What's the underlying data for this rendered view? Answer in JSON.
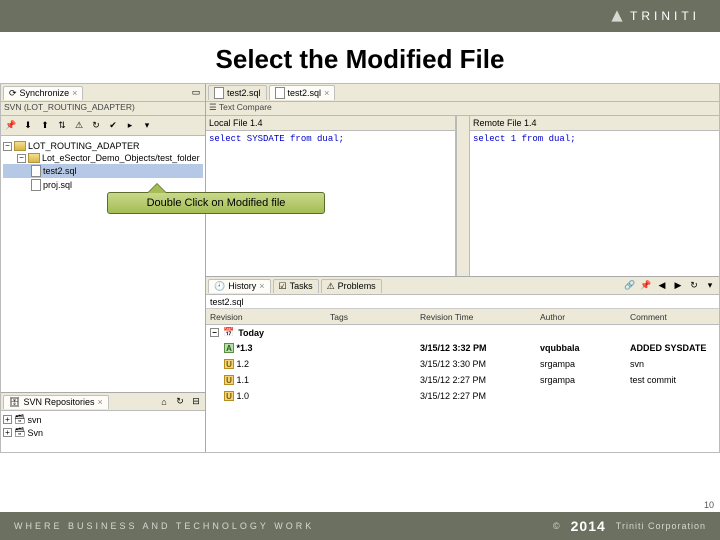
{
  "brand": {
    "name": "TRINITI",
    "tagline": "WHERE BUSINESS AND TECHNOLOGY WORK",
    "year": "2014",
    "corp": "Triniti Corporation"
  },
  "slide": {
    "title": "Select the Modified File",
    "page": "10"
  },
  "callout": {
    "text": "Double Click on  Modified file"
  },
  "sync": {
    "tab": "Synchronize",
    "desc": "SVN (LOT_ROUTING_ADAPTER)",
    "root": "LOT_ROUTING_ADAPTER",
    "folder": "Lot_eSector_Demo_Objects/test_folder",
    "file1": "test2.sql",
    "file2": "proj.sql"
  },
  "repos": {
    "tab": "SVN Repositories",
    "item1": "svn",
    "item2": "Svn"
  },
  "editor": {
    "tab1": "test2.sql",
    "tab2": "test2.sql",
    "compare_title": "Text Compare",
    "left_title": "Local File 1.4",
    "right_title": "Remote File 1.4",
    "left_sql": "select SYSDATE from dual;",
    "right_sql": "select 1 from dual;"
  },
  "history": {
    "tabs": {
      "history": "History",
      "tasks": "Tasks",
      "problems": "Problems"
    },
    "file": "test2.sql",
    "group": "Today",
    "cols": {
      "rev": "Revision",
      "tags": "Tags",
      "time": "Revision Time",
      "author": "Author",
      "comment": "Comment"
    },
    "rows": [
      {
        "icon": "A",
        "rev": "*1.3",
        "time": "3/15/12 3:32 PM",
        "author": "vqubbala",
        "comment": "ADDED SYSDATE",
        "bold": true
      },
      {
        "icon": "U",
        "rev": "1.2",
        "time": "3/15/12 3:30 PM",
        "author": "srgampa",
        "comment": "svn",
        "bold": false
      },
      {
        "icon": "U",
        "rev": "1.1",
        "time": "3/15/12 2:27 PM",
        "author": "srgampa",
        "comment": "test commit",
        "bold": false
      },
      {
        "icon": "U",
        "rev": "1.0",
        "time": "3/15/12 2:27 PM",
        "author": "",
        "comment": "",
        "bold": false
      }
    ]
  }
}
